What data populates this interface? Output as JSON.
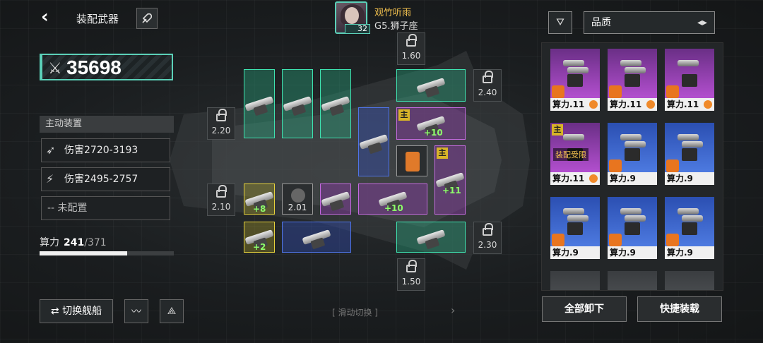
{
  "header": {
    "title": "装配武器"
  },
  "pilot": {
    "name": "观竹听雨",
    "rank": "G5.狮子座",
    "level": "32"
  },
  "power": {
    "value": "35698"
  },
  "equip_section": {
    "label": "主动装置",
    "items": [
      {
        "label": "伤害2720-3193",
        "icon": "missile-icon"
      },
      {
        "label": "伤害2495-2757",
        "icon": "lightning-icon"
      },
      {
        "label": "-- 未配置",
        "icon": ""
      }
    ]
  },
  "compute": {
    "label": "算力",
    "current": "241",
    "max": "/371",
    "fraction": 0.65
  },
  "bottom_left": {
    "switch_label": "⇄ 切换舰船",
    "slide_hint": "[ 滑动切换 ]"
  },
  "locks": [
    "1.60",
    "2.40",
    "2.20",
    "2.10",
    "2.30",
    "1.50"
  ],
  "slots": {
    "bonus": [
      "+10",
      "+11",
      "+8",
      "+10",
      "+2"
    ],
    "main_tag": "主",
    "dark_slot_value": "2.01"
  },
  "right_panel": {
    "sort_label": "品质",
    "cards": [
      {
        "label": "算力.11",
        "rarity": "purple"
      },
      {
        "label": "算力.11",
        "rarity": "purple"
      },
      {
        "label": "算力.11",
        "rarity": "purple"
      },
      {
        "label": "算力.11",
        "rarity": "purple",
        "warning": "装配受限",
        "main_tag": "主"
      },
      {
        "label": "算力.9",
        "rarity": "blue"
      },
      {
        "label": "算力.9",
        "rarity": "blue"
      },
      {
        "label": "算力.9",
        "rarity": "blue"
      },
      {
        "label": "算力.9",
        "rarity": "blue"
      },
      {
        "label": "算力.9",
        "rarity": "blue"
      }
    ],
    "unload_all": "全部卸下",
    "quick_equip": "快捷装载"
  },
  "colors": {
    "accent": "#5bd0b8",
    "green_slot": "#3ee3b0",
    "purple_slot": "#c56ae0",
    "blue_slot": "#4f74e8",
    "yellow_slot": "#e6d23c"
  }
}
